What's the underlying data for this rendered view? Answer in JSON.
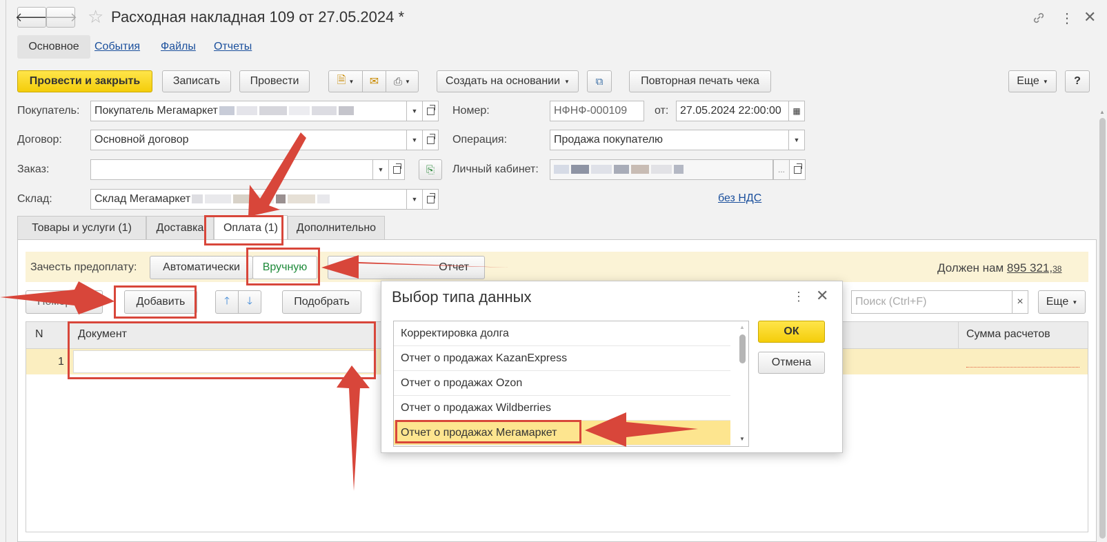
{
  "window": {
    "title": "Расходная накладная 109 от 27.05.2024 *",
    "nav_back": "🡐",
    "nav_forward": "🡒",
    "icons": [
      "link-icon",
      "more-vertical-icon",
      "close-icon"
    ]
  },
  "section_tabs": [
    "Основное",
    "События",
    "Файлы",
    "Отчеты"
  ],
  "toolbar": {
    "post_close": "Провести и закрыть",
    "save": "Записать",
    "post": "Провести",
    "create_based_on": "Создать на основании",
    "reprint_receipt": "Повторная печать чека",
    "more": "Еще",
    "help": "?"
  },
  "form": {
    "buyer_label": "Покупатель:",
    "buyer_value": "Покупатель Мегамаркет",
    "contract_label": "Договор:",
    "contract_value": "Основной договор",
    "order_label": "Заказ:",
    "order_value": "",
    "warehouse_label": "Склад:",
    "warehouse_value": "Склад Мегамаркет",
    "number_label": "Номер:",
    "number_value": "НФНФ-000109",
    "date_label": "от:",
    "date_value": "27.05.2024 22:00:00",
    "operation_label": "Операция:",
    "operation_value": "Продажа покупателю",
    "cabinet_label": "Личный кабинет:",
    "cabinet_value": "",
    "cabinet_ellipsis": "...",
    "vat_link": "без НДС"
  },
  "doc_tabs": [
    "Товары и услуги (1)",
    "Доставка",
    "Оплата (1)",
    "Дополнительно"
  ],
  "payment": {
    "prepay_label": "Зачесть предоплату:",
    "auto": "Автоматически",
    "manual": "Вручную",
    "report_btn": "Отчет",
    "owes_label": "Должен нам",
    "owes_amount": "895 321,",
    "owes_cents": "38"
  },
  "table_toolbar": {
    "number_partial": "Номер",
    "add": "Добавить",
    "select": "Подобрать",
    "search_placeholder": "Поиск (Ctrl+F)",
    "search_clear": "×",
    "more": "Еще"
  },
  "table": {
    "col_n": "N",
    "col_document": "Документ",
    "col_sum": "Сумма расчетов",
    "rows": [
      {
        "n": "1",
        "document": ""
      }
    ]
  },
  "dialog": {
    "title": "Выбор типа данных",
    "ok": "ОК",
    "cancel": "Отмена",
    "items": [
      "Корректировка долга",
      "Отчет о продажах KazanExpress",
      "Отчет о продажах Ozon",
      "Отчет о продажах Wildberries",
      "Отчет о продажах Мегамаркет"
    ],
    "selected_index": 4
  },
  "colors": {
    "annotation_red": "#d8463a",
    "primary_yellow": "#f4cd0a",
    "selected_row": "#fde58f",
    "link_blue": "#1a4f9c",
    "manual_green": "#1e8a3a"
  }
}
